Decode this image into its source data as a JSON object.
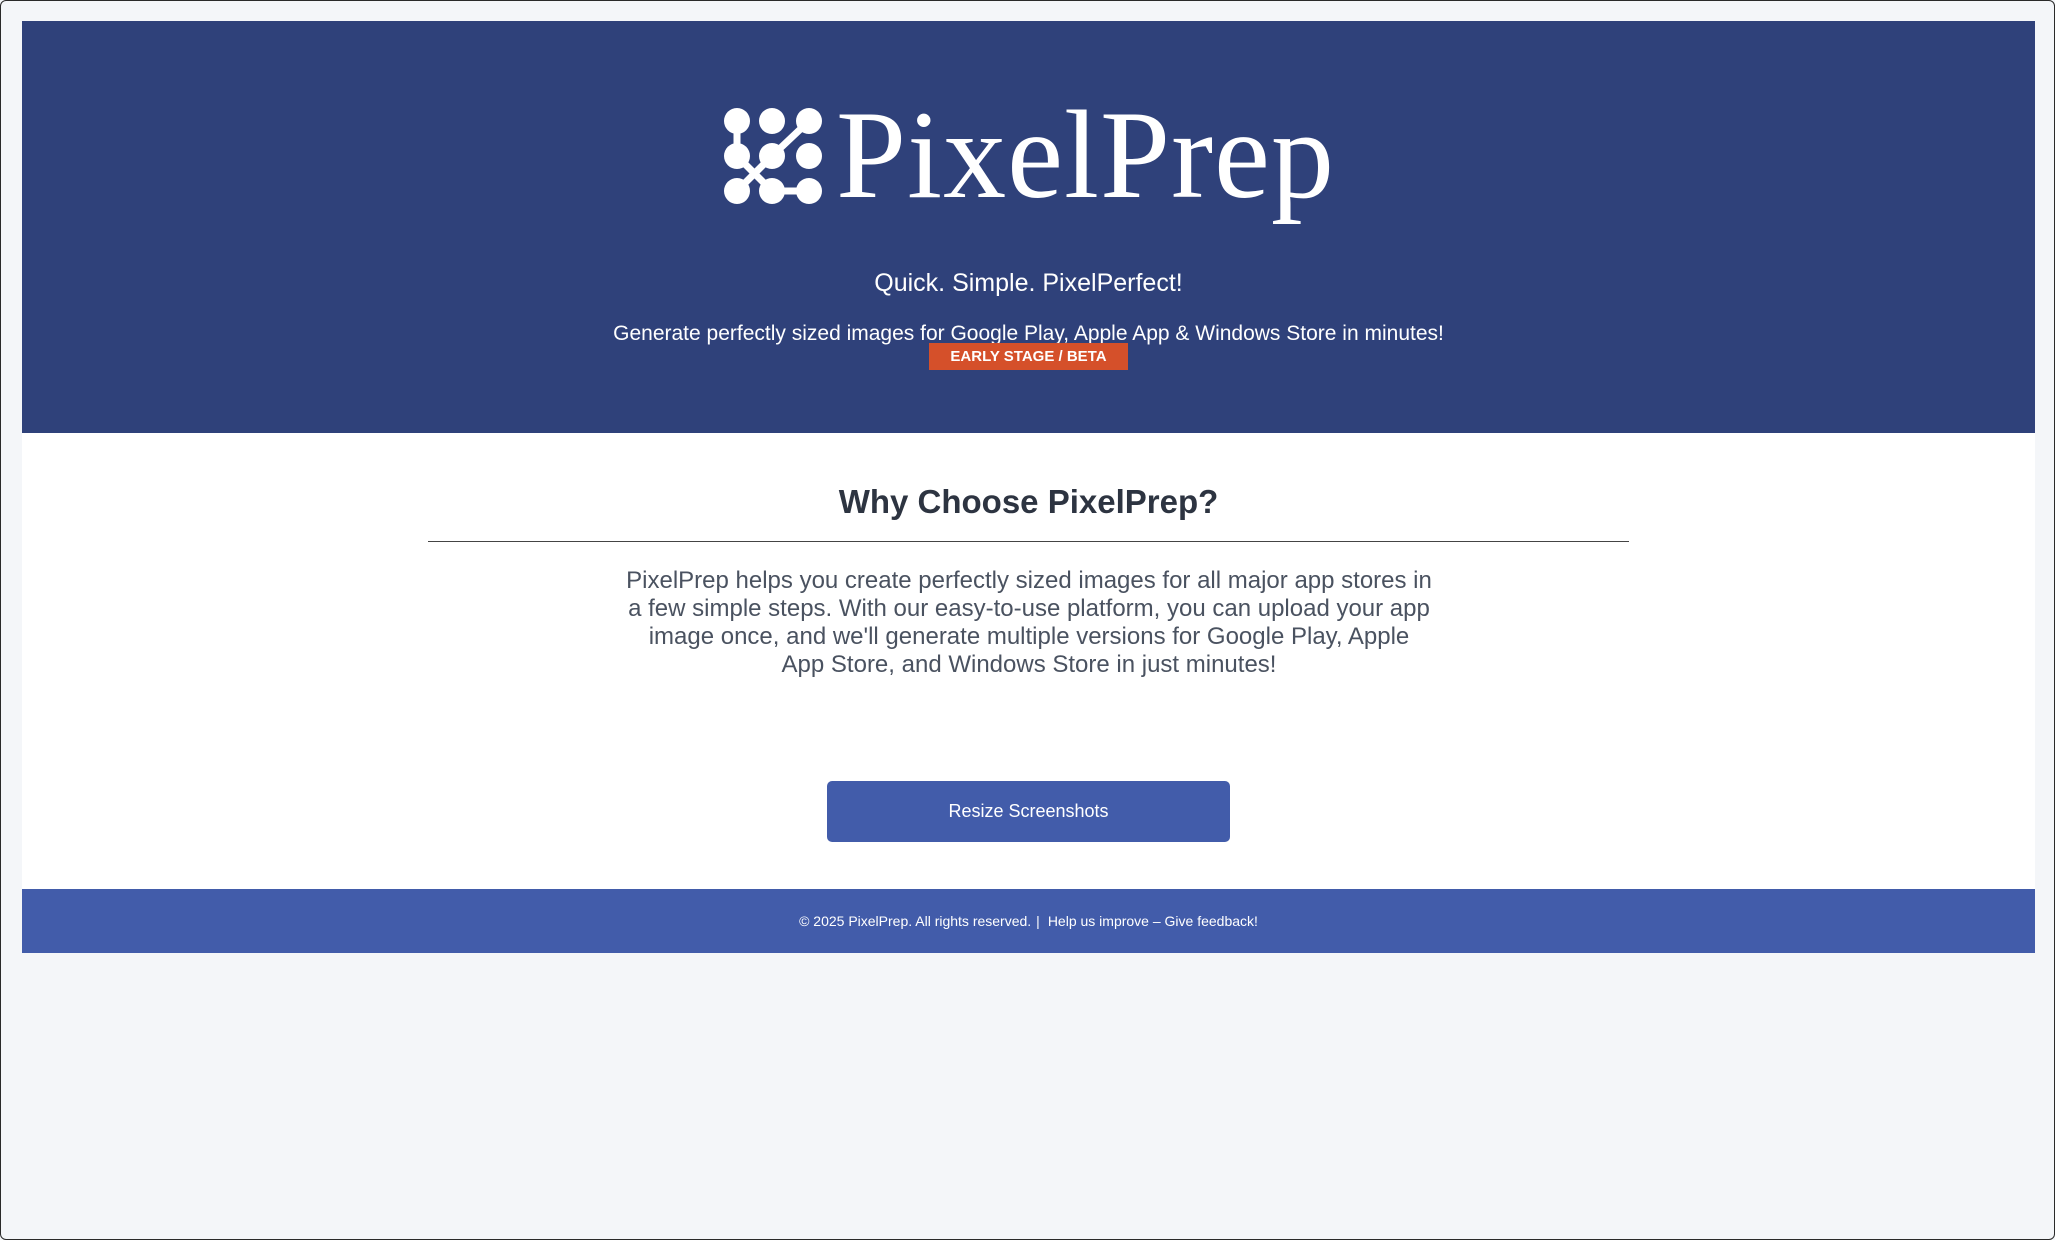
{
  "header": {
    "brand": "PixelPrep",
    "logo_icon": "dots-path-logo-icon",
    "tagline": "Quick. Simple. PixelPerfect!",
    "subtitle": "Generate perfectly sized images for Google Play, Apple App & Windows Store in minutes!",
    "badge": "EARLY STAGE / BETA"
  },
  "main": {
    "heading": "Why Choose PixelPrep?",
    "description": "PixelPrep helps you create perfectly sized images for all major app stores in a few simple steps. With our easy-to-use platform, you can upload your app image once, and we'll generate multiple versions for Google Play, Apple App Store, and Windows Store in just minutes!",
    "cta_label": "Resize Screenshots"
  },
  "footer": {
    "copyright": "© 2025 PixelPrep. All rights reserved.",
    "separator": "|",
    "feedback_link": "Help us improve – Give feedback!"
  },
  "colors": {
    "hero_bg": "#2f417a",
    "accent_blue": "#425caa",
    "badge_orange": "#d5502a",
    "page_bg": "#f4f6f9"
  }
}
